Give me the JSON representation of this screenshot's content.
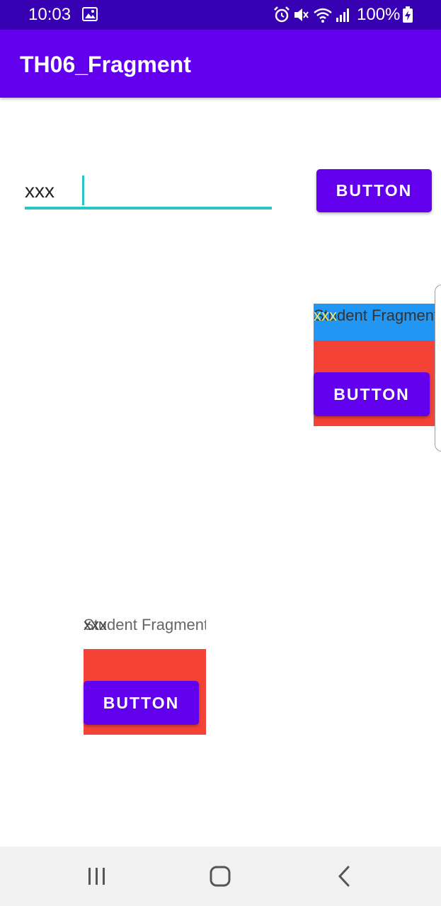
{
  "status_bar": {
    "time": "10:03",
    "battery_percent": "100%",
    "icons": [
      "image-icon",
      "alarm-icon",
      "mute-icon",
      "wifi-icon",
      "signal-icon",
      "battery-charging-icon"
    ]
  },
  "app_bar": {
    "title": "TH06_Fragment"
  },
  "main": {
    "input": {
      "value": "xxx"
    },
    "button_label": "BUTTON"
  },
  "fragment_right": {
    "student_text": "Student Fragment",
    "overlay_text": "xxx",
    "button_label": "BUTTON"
  },
  "fragment_bottom": {
    "student_text": "Student Fragment",
    "overlay_text": "xxx",
    "button_label": "BUTTON"
  },
  "nav_bar": {
    "icons": [
      "recents-icon",
      "home-icon",
      "back-icon"
    ]
  },
  "colors": {
    "status_bar": "#3700b3",
    "app_bar": "#6200ee",
    "button": "#6200ee",
    "accent": "#26c6c6",
    "fragment_blue": "#2196f3",
    "fragment_red": "#f44336"
  }
}
